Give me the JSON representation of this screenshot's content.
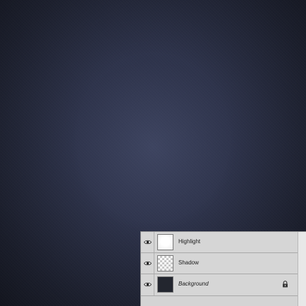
{
  "canvas": {
    "texture": "dark navy leather/denim texture with vignette"
  },
  "layers_panel": {
    "layers": [
      {
        "name": "Highlight",
        "visible": true,
        "thumbnail": "white-glow",
        "locked": false,
        "italic": false
      },
      {
        "name": "Shadow",
        "visible": true,
        "thumbnail": "transparent-checker",
        "locked": false,
        "italic": false
      },
      {
        "name": "Background",
        "visible": true,
        "thumbnail": "dark-fill",
        "locked": true,
        "italic": true
      }
    ],
    "icons": {
      "visibility": "eye-icon",
      "lock": "lock-icon"
    }
  }
}
